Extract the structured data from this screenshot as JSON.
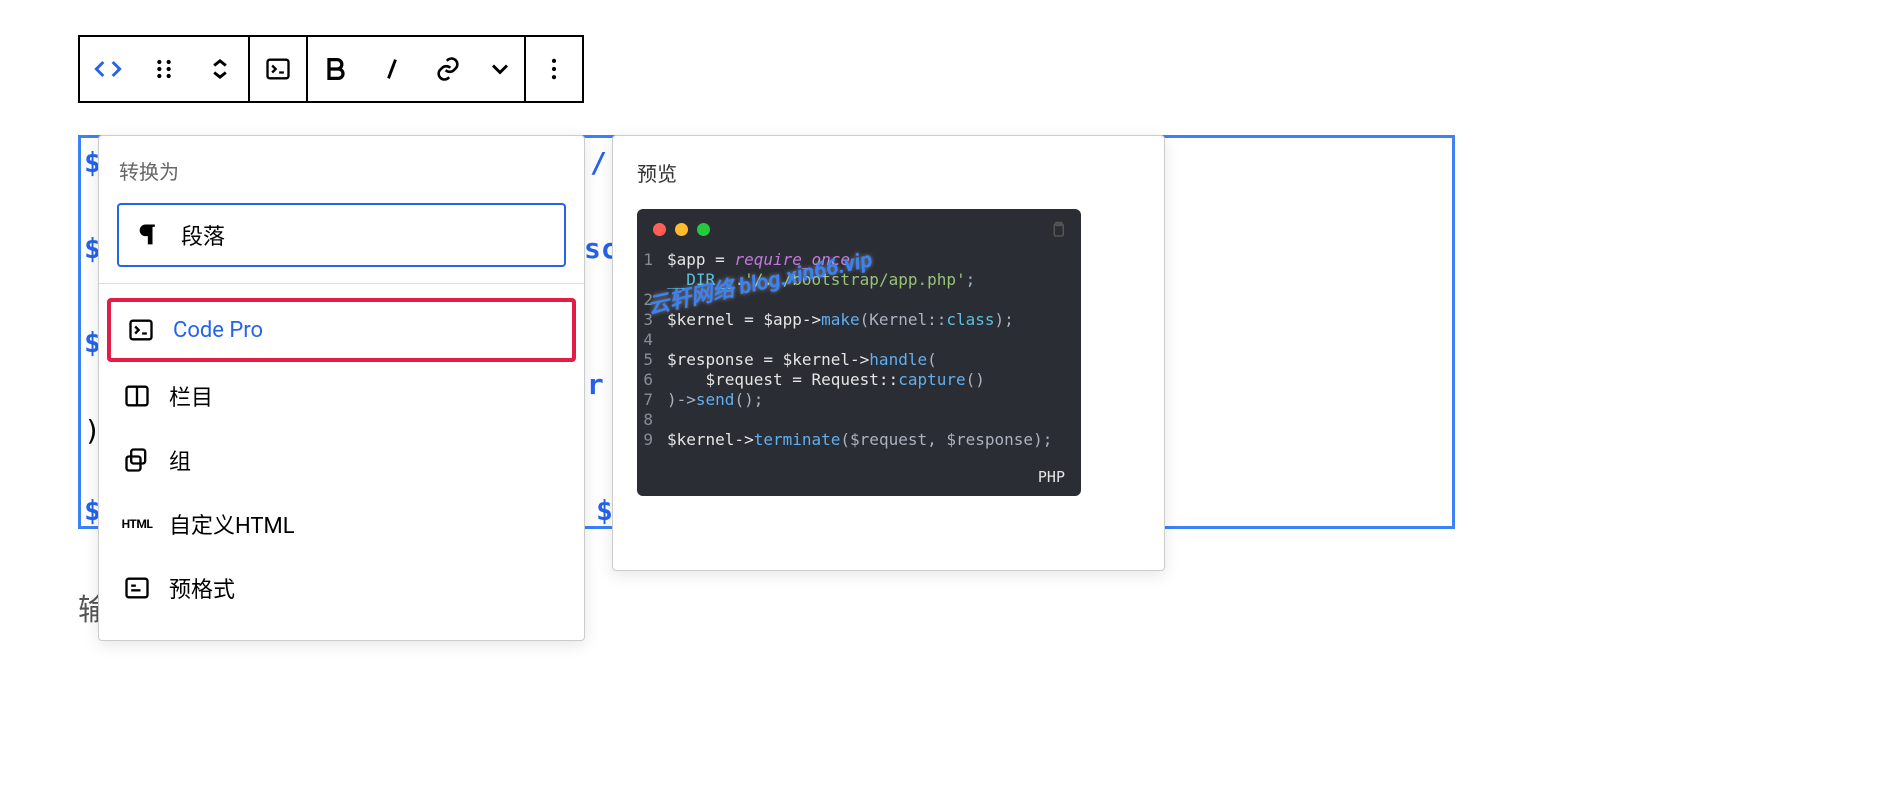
{
  "popup": {
    "title": "转换为",
    "selected": "段落",
    "items": [
      "Code Pro",
      "栏目",
      "组",
      "自定义HTML",
      "预格式"
    ]
  },
  "preview": {
    "title": "预览",
    "language": "PHP",
    "lines": {
      "l1a": "$app = ",
      "l1b": "require_once",
      "l2a": "__DIR__",
      "l2b": ".",
      "l2c": "'/../bootstrap/app.php'",
      "l2d": ";",
      "l3a": "$kernel = $app->",
      "l3b": "make",
      "l3c": "(Kernel::",
      "l3d": "class",
      "l3e": ");",
      "l5a": "$response = $kernel->",
      "l5b": "handle",
      "l5c": "(",
      "l6a": "    $request = Request::",
      "l6b": "capture",
      "l6c": "()",
      "l7a": ")->",
      "l7b": "send",
      "l7c": "();",
      "l9a": "$kernel->",
      "l9b": "terminate",
      "l9c": "($request, $response);"
    }
  },
  "watermark": "云轩网络 blog.xin66.vip",
  "placeholder": "输入/来选择一个区块",
  "bg": {
    "l1": "$",
    "l2": "$",
    "l3": "$",
    "l4": "$",
    "slash": " /",
    "sc": "sc",
    "ur": "ur",
    "dollar2": "$"
  }
}
